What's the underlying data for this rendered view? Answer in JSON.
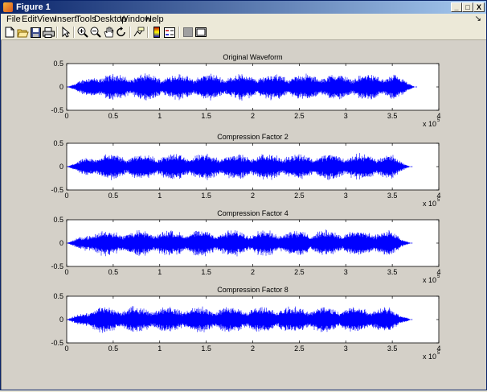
{
  "window": {
    "title": "Figure 1"
  },
  "window_controls": {
    "minimize": "_",
    "maximize": "□",
    "close": "X"
  },
  "menu": [
    "File",
    "Edit",
    "View",
    "Insert",
    "Tools",
    "Desktop",
    "Window",
    "Help"
  ],
  "menu_dock_arrow": "↘",
  "toolbar_icons": [
    "new-figure-icon",
    "open-file-icon",
    "save-icon",
    "print-icon",
    "select-arrow-icon",
    "zoom-in-icon",
    "zoom-out-icon",
    "pan-hand-icon",
    "rotate-3d-icon",
    "data-cursor-icon",
    "colorbar-icon",
    "legend-icon",
    "hide-plot-tools-icon",
    "show-plot-tools-icon"
  ],
  "colors": {
    "waveform": "#0000ff",
    "figure_bg": "#d4d0c8",
    "axes_bg": "#ffffff"
  },
  "chart_data": [
    {
      "type": "line",
      "title": "Original Waveform",
      "xlabel": "",
      "ylabel": "",
      "xlim": [
        0,
        4
      ],
      "ylim": [
        -0.5,
        0.5
      ],
      "x_exponent_label": "x 10",
      "x_exponent": "5",
      "xticks": [
        "0",
        "0.5",
        "1",
        "1.5",
        "2",
        "2.5",
        "3",
        "3.5",
        "4"
      ],
      "yticks": [
        "0.5",
        "0",
        "-0.5"
      ],
      "signal_end_x": 3.75,
      "peak_amplitude": 0.3
    },
    {
      "type": "line",
      "title": "Compression Factor 2",
      "xlabel": "",
      "ylabel": "",
      "xlim": [
        0,
        4
      ],
      "ylim": [
        -0.5,
        0.5
      ],
      "x_exponent_label": "x 10",
      "x_exponent": "5",
      "xticks": [
        "0",
        "0.5",
        "1",
        "1.5",
        "2",
        "2.5",
        "3",
        "3.5",
        "4"
      ],
      "yticks": [
        "0.5",
        "0",
        "-0.5"
      ],
      "signal_end_x": 3.7,
      "peak_amplitude": 0.3
    },
    {
      "type": "line",
      "title": "Compression Factor 4",
      "xlabel": "",
      "ylabel": "",
      "xlim": [
        0,
        4
      ],
      "ylim": [
        -0.5,
        0.5
      ],
      "x_exponent_label": "x 10",
      "x_exponent": "5",
      "xticks": [
        "0",
        "0.5",
        "1",
        "1.5",
        "2",
        "2.5",
        "3",
        "3.5",
        "4"
      ],
      "yticks": [
        "0.5",
        "0",
        "-0.5"
      ],
      "signal_end_x": 3.7,
      "peak_amplitude": 0.3
    },
    {
      "type": "line",
      "title": "Compression Factor 8",
      "xlabel": "",
      "ylabel": "",
      "xlim": [
        0,
        4
      ],
      "ylim": [
        -0.5,
        0.5
      ],
      "x_exponent_label": "x 10",
      "x_exponent": "5",
      "xticks": [
        "0",
        "0.5",
        "1",
        "1.5",
        "2",
        "2.5",
        "3",
        "3.5",
        "4"
      ],
      "yticks": [
        "0.5",
        "0",
        "-0.5"
      ],
      "signal_end_x": 3.7,
      "peak_amplitude": 0.3
    }
  ]
}
